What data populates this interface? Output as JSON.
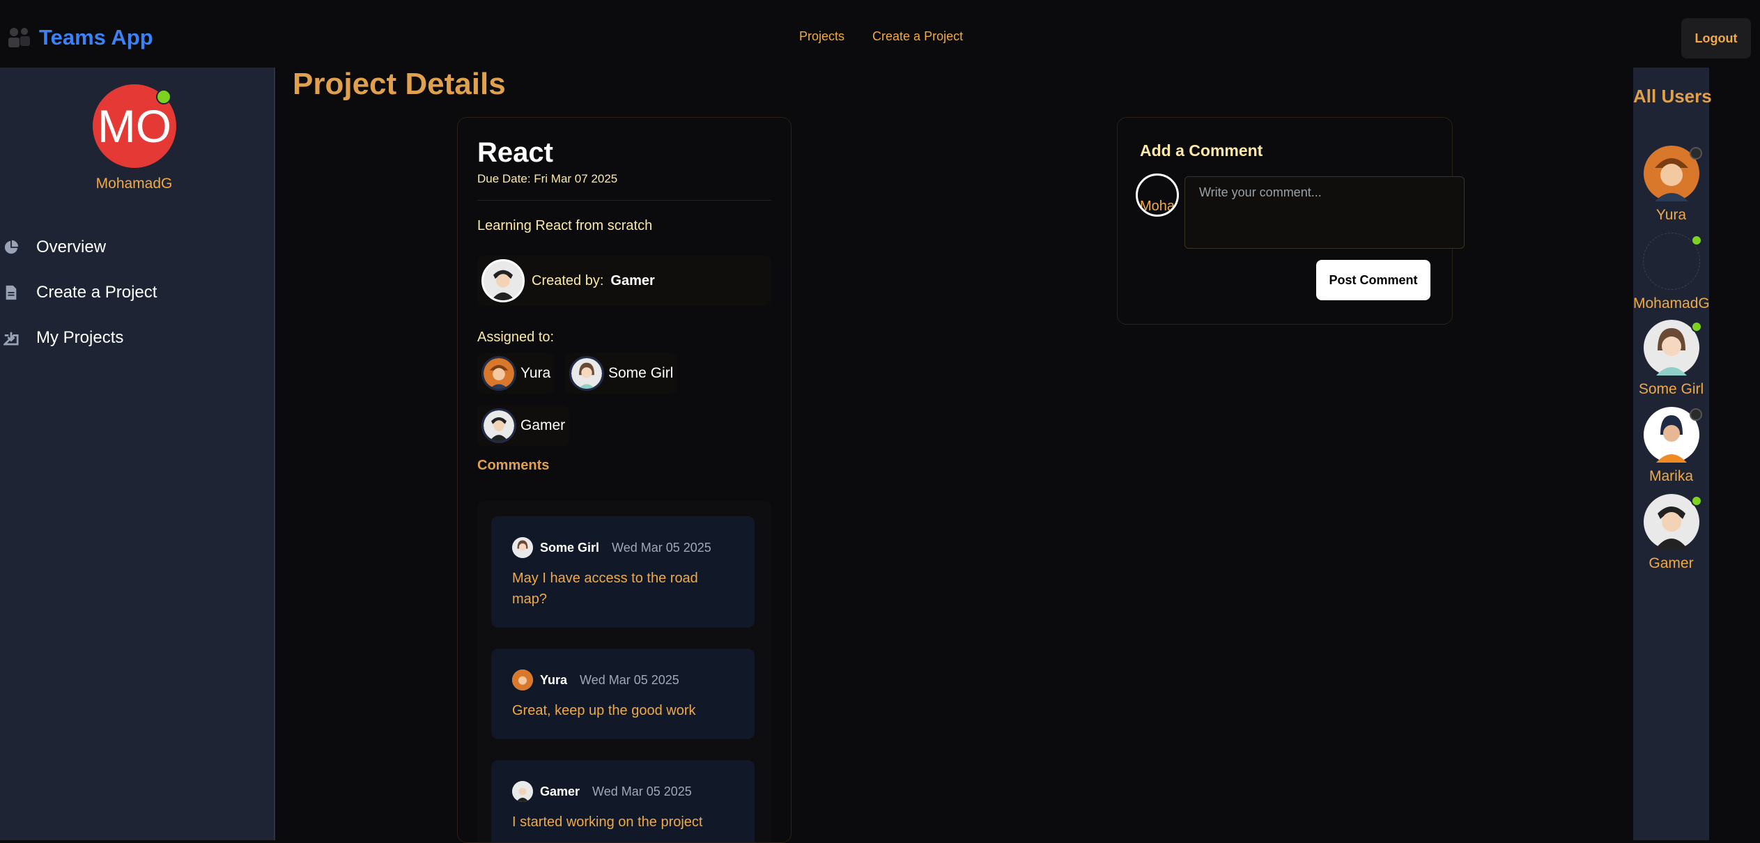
{
  "navbar": {
    "brand": "Teams App",
    "links": [
      "Projects",
      "Create a Project"
    ],
    "logout": "Logout"
  },
  "sidebar": {
    "avatar_initials": "MO",
    "username": "MohamadG",
    "items": [
      {
        "label": "Overview",
        "icon": "pie-chart-icon"
      },
      {
        "label": "Create a Project",
        "icon": "document-icon"
      },
      {
        "label": "My Projects",
        "icon": "download-box-icon"
      }
    ]
  },
  "page": {
    "title": "Project Details"
  },
  "project": {
    "name": "React",
    "due_date": "Due Date: Fri Mar 07 2025",
    "description": "Learning React from scratch",
    "created_by_label": "Created by:",
    "created_by": "Gamer",
    "assigned_label": "Assigned to:",
    "assigned": [
      "Yura",
      "Some Girl",
      "Gamer"
    ],
    "comments_label": "Comments",
    "comments": [
      {
        "author": "Some Girl",
        "date": "Wed Mar 05 2025",
        "text": "May I have access to the road map?"
      },
      {
        "author": "Yura",
        "date": "Wed Mar 05 2025",
        "text": "Great, keep up the good work"
      },
      {
        "author": "Gamer",
        "date": "Wed Mar 05 2025",
        "text": "I started working on the project"
      }
    ]
  },
  "add_comment": {
    "title": "Add a Comment",
    "avatar_alt": "Moha",
    "placeholder": "Write your comment...",
    "submit": "Post Comment"
  },
  "users": {
    "title": "All Users",
    "list": [
      {
        "name": "Yura",
        "status": "offline"
      },
      {
        "name": "MohamadG",
        "status": "online"
      },
      {
        "name": "Some Girl",
        "status": "online"
      },
      {
        "name": "Marika",
        "status": "offline"
      },
      {
        "name": "Gamer",
        "status": "online"
      }
    ]
  },
  "colors": {
    "accent": "#f0a945",
    "brand": "#3b82f6",
    "online": "#7ed321",
    "avatar_bg": "#e53935"
  }
}
